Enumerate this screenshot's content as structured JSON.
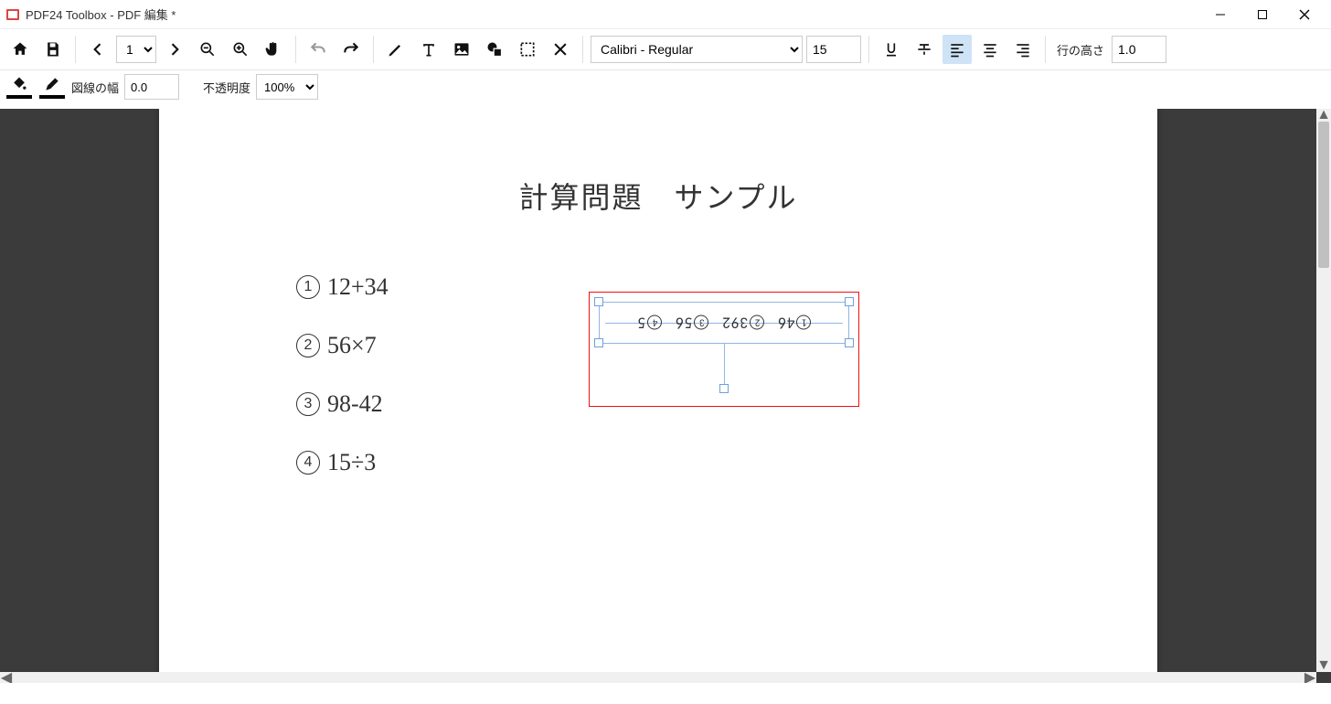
{
  "window": {
    "title": "PDF24 Toolbox - PDF 編集 *"
  },
  "toolbar": {
    "page_value": "1",
    "font_value": "Calibri - Regular",
    "fontsize_value": "15",
    "lineheight_label": "行の高さ",
    "lineheight_value": "1.0"
  },
  "toolbar2": {
    "linewidth_label": "図線の幅",
    "linewidth_value": "0.0",
    "opacity_label": "不透明度",
    "opacity_value": "100%"
  },
  "document": {
    "title": "計算問題　サンプル",
    "problems": [
      {
        "num": "1",
        "expr": "12+34"
      },
      {
        "num": "2",
        "expr": "56×7"
      },
      {
        "num": "3",
        "expr": "98-42"
      },
      {
        "num": "4",
        "expr": "15÷3"
      }
    ],
    "answers": [
      {
        "num": "1",
        "val": "46"
      },
      {
        "num": "2",
        "val": "392"
      },
      {
        "num": "3",
        "val": "56"
      },
      {
        "num": "4",
        "val": "5"
      }
    ]
  }
}
